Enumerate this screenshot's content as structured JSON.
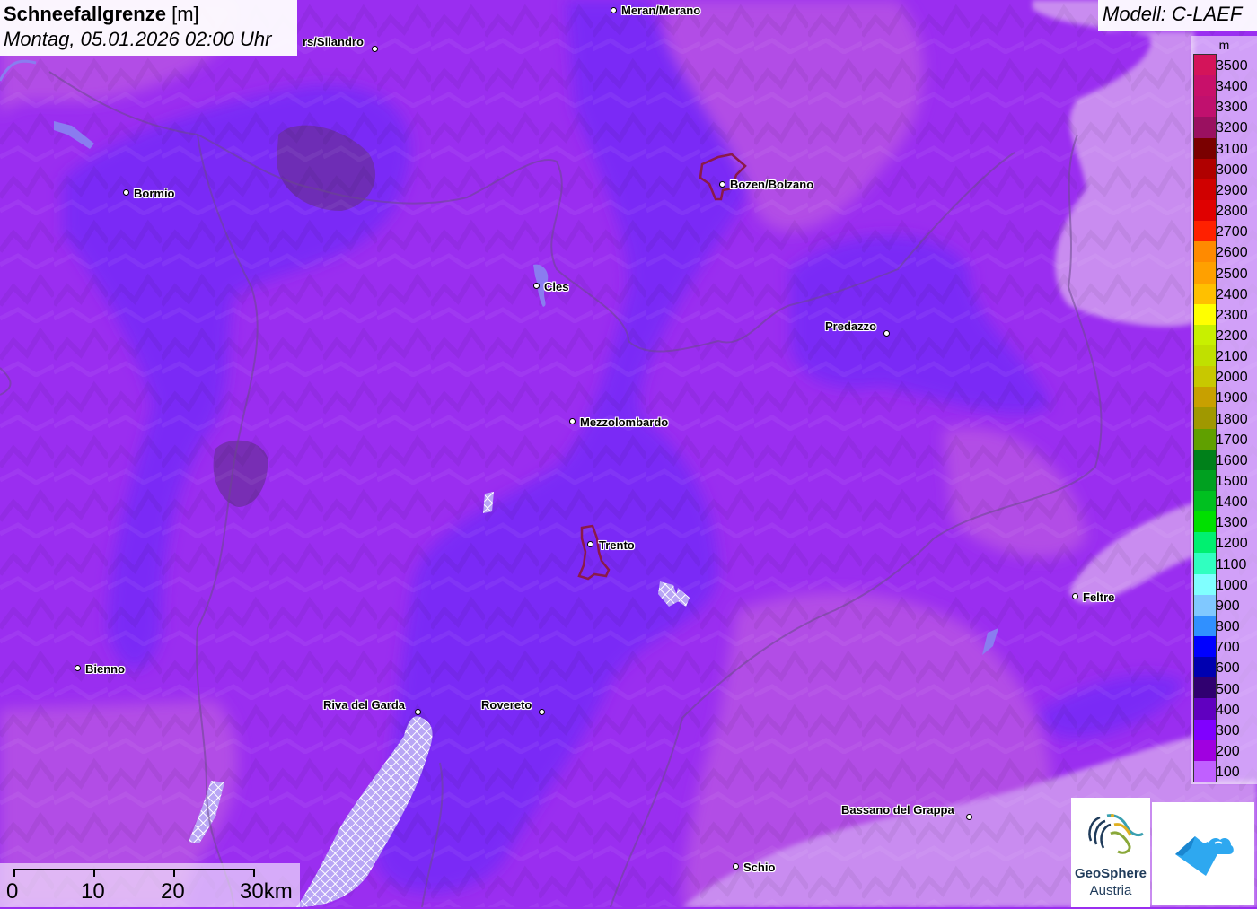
{
  "title": {
    "variable": "Schneefallgrenze",
    "unit": "[m]",
    "datetime": "Montag, 05.01.2026 02:00 Uhr"
  },
  "model": "Modell: C-LAEF",
  "legend": {
    "unit": "m",
    "levels": [
      {
        "label": "3500",
        "color": "#d4145a"
      },
      {
        "label": "3400",
        "color": "#c8106a"
      },
      {
        "label": "3300",
        "color": "#c0106e"
      },
      {
        "label": "3200",
        "color": "#9a1060"
      },
      {
        "label": "3100",
        "color": "#7a0000"
      },
      {
        "label": "3000",
        "color": "#b00000"
      },
      {
        "label": "2900",
        "color": "#d00000"
      },
      {
        "label": "2800",
        "color": "#e00000"
      },
      {
        "label": "2700",
        "color": "#ff2000"
      },
      {
        "label": "2600",
        "color": "#ff8a00"
      },
      {
        "label": "2500",
        "color": "#ffa000"
      },
      {
        "label": "2400",
        "color": "#ffc000"
      },
      {
        "label": "2300",
        "color": "#ffff00"
      },
      {
        "label": "2200",
        "color": "#c8f000"
      },
      {
        "label": "2100",
        "color": "#c0e000"
      },
      {
        "label": "2000",
        "color": "#c8c800"
      },
      {
        "label": "1900",
        "color": "#c8a000"
      },
      {
        "label": "1800",
        "color": "#a09800"
      },
      {
        "label": "1700",
        "color": "#60a000"
      },
      {
        "label": "1600",
        "color": "#00801a"
      },
      {
        "label": "1500",
        "color": "#00a020"
      },
      {
        "label": "1400",
        "color": "#00c020"
      },
      {
        "label": "1300",
        "color": "#00e000"
      },
      {
        "label": "1200",
        "color": "#00f070"
      },
      {
        "label": "1100",
        "color": "#30ffc0"
      },
      {
        "label": "1000",
        "color": "#80ffff"
      },
      {
        "label": "900",
        "color": "#80c8ff"
      },
      {
        "label": "800",
        "color": "#3090ff"
      },
      {
        "label": "700",
        "color": "#0000ff"
      },
      {
        "label": "600",
        "color": "#0000b0"
      },
      {
        "label": "500",
        "color": "#300070"
      },
      {
        "label": "400",
        "color": "#6000c0"
      },
      {
        "label": "300",
        "color": "#8000ff"
      },
      {
        "label": "200",
        "color": "#a000e0"
      },
      {
        "label": "100",
        "color": "#c060ff"
      }
    ]
  },
  "cities": [
    {
      "name": "Meran/Merano"
    },
    {
      "name": "rs/Silandro"
    },
    {
      "name": "Bormio"
    },
    {
      "name": "Bozen/Bolzano"
    },
    {
      "name": "Cles"
    },
    {
      "name": "Predazzo"
    },
    {
      "name": "Mezzolombardo"
    },
    {
      "name": "Trento"
    },
    {
      "name": "Feltre"
    },
    {
      "name": "Bienno"
    },
    {
      "name": "Riva del Garda"
    },
    {
      "name": "Rovereto"
    },
    {
      "name": "Bassano del Grappa"
    },
    {
      "name": "Schio"
    }
  ],
  "scale": {
    "labels": [
      "0",
      "10",
      "20",
      "30km"
    ]
  },
  "logos": {
    "geosphere_name": "GeoSphere",
    "geosphere_sub": "Austria"
  },
  "colors": {
    "field_main": "#9a2ef0",
    "field_low": "#7a2cf6",
    "field_high": "#b052e8",
    "field_pale": "#c98cf0"
  }
}
